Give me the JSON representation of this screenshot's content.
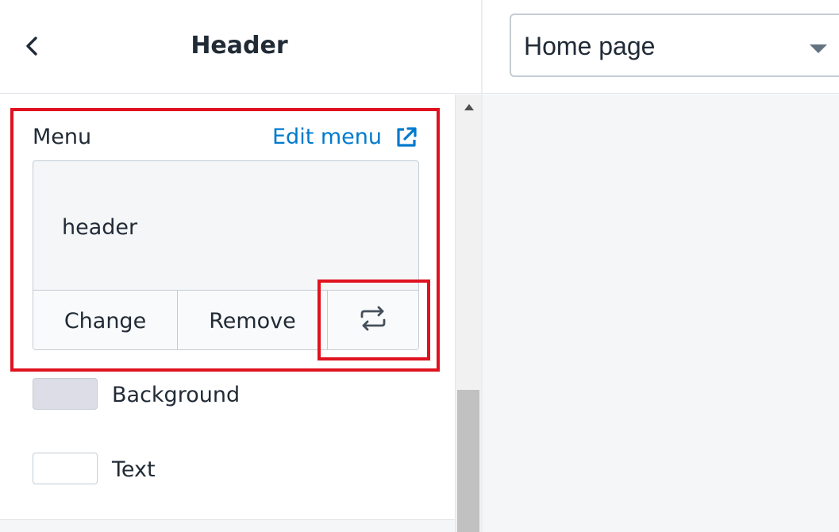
{
  "header": {
    "title": "Header",
    "back_icon": "chevron-left-icon"
  },
  "menu": {
    "label": "Menu",
    "edit_link": "Edit menu",
    "edit_link_icon": "external-link-icon",
    "link_color": "#007ace",
    "selected_menu": "header",
    "actions": {
      "change": "Change",
      "remove": "Remove",
      "swap_icon": "swap-arrows-icon"
    }
  },
  "colors": [
    {
      "label": "Background",
      "swatch": "#dcdde6"
    },
    {
      "label": "Text",
      "swatch": "#ffffff"
    }
  ],
  "page_selector": {
    "value": "Home page",
    "caret_icon": "caret-down-icon"
  },
  "highlight_color": "#e0121f"
}
